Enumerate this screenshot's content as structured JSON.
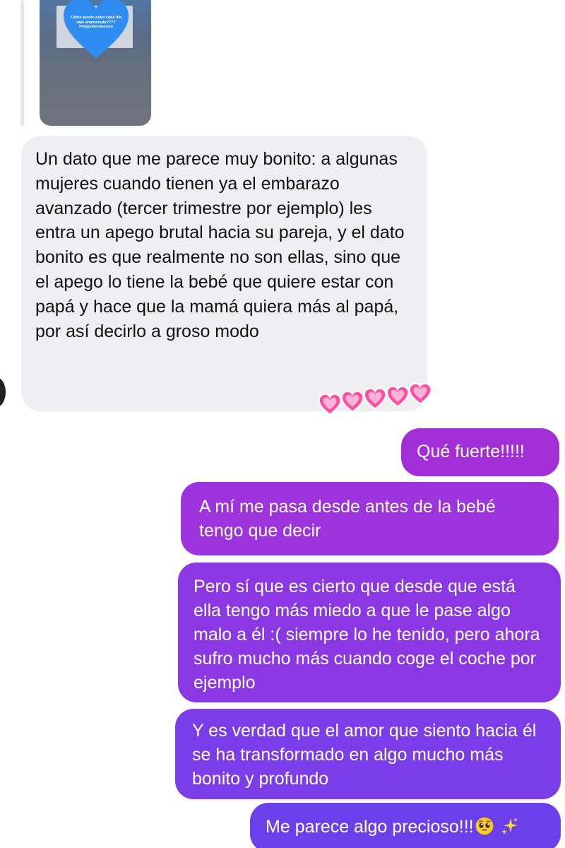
{
  "story_reply": {
    "story_text": "Cómo puedo estar cada día más enamorada???? Preguntoooooooo",
    "heart_color": "#2f8cf0"
  },
  "received": {
    "message": "Un dato que me parece muy bonito: a algunas mujeres cuando tienen ya el embarazo avanzado (tercer trimestre por ejemplo) les entra un apego brutal hacia su pareja, y el dato bonito es que realmente no son ellas, sino que el apego lo tiene la bebé que quiere estar con papá y hace que la mamá quiera más al papá, por así decirlo a groso modo",
    "reactions": [
      "pink-heart",
      "pink-heart",
      "pink-heart",
      "pink-heart",
      "pink-heart"
    ],
    "bubble_color": "#efeff2"
  },
  "sent": [
    {
      "text": "Qué fuerte!!!!!",
      "color": "#a22fd6"
    },
    {
      "text": "A mí me pasa desde antes de la bebé tengo que decir",
      "color": "#9c33dc"
    },
    {
      "text": "Pero sí que es cierto que desde que está ella tengo más miedo a que le pase algo malo a él :( siempre lo he tenido, pero ahora sufro mucho más cuando coge el coche por ejemplo",
      "color": "#8b38e4"
    },
    {
      "text": "Y es verdad que el amor que siento hacia él se ha transformado en algo mucho más bonito y profundo",
      "color": "#7a3de8"
    },
    {
      "text": "Me parece algo precioso!!!",
      "color": "#6a40ec",
      "emojis": [
        "pleading-face",
        "sparkles"
      ]
    }
  ]
}
